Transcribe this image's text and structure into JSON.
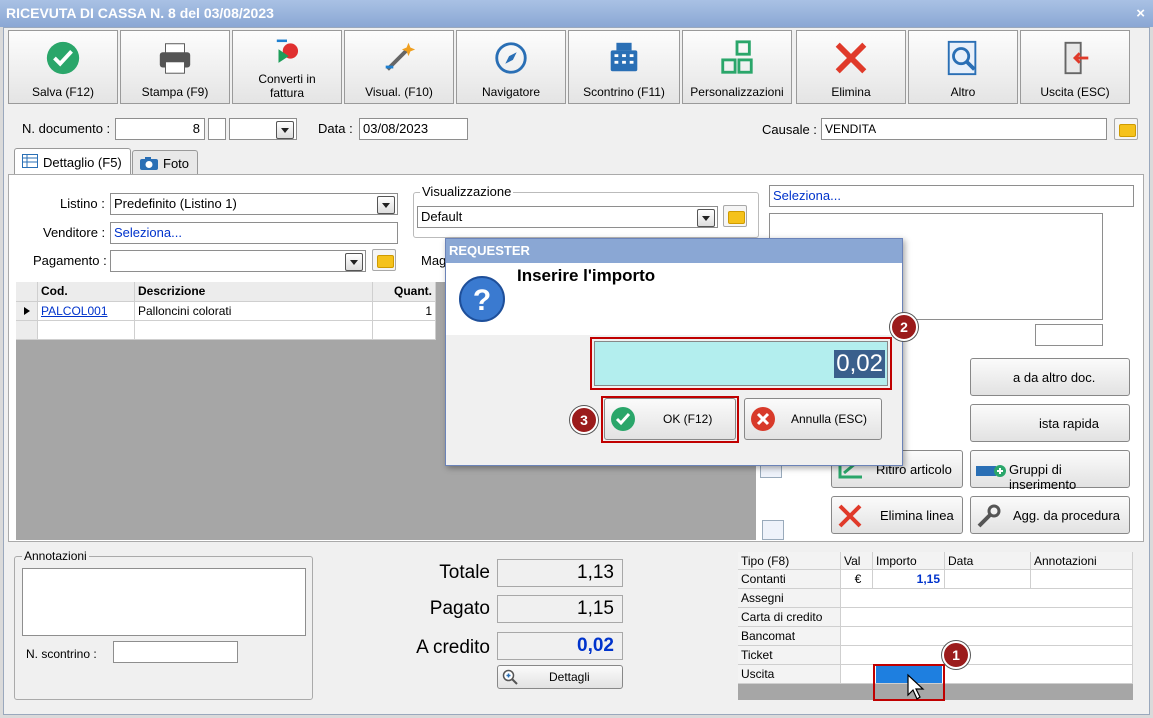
{
  "window": {
    "title": "RICEVUTA DI CASSA N. 8 del 03/08/2023",
    "close": "×"
  },
  "toolbar": {
    "salva": "Salva (F12)",
    "stampa": "Stampa (F9)",
    "converti_1": "Converti in",
    "converti_2": "fattura",
    "visual": "Visual. (F10)",
    "navigatore": "Navigatore",
    "scontrino": "Scontrino (F11)",
    "personalizzazioni": "Personalizzazioni",
    "elimina": "Elimina",
    "altro": "Altro",
    "uscita": "Uscita (ESC)"
  },
  "header": {
    "ndoc_label": "N. documento :",
    "ndoc_value": "8",
    "data_label": "Data :",
    "data_value": "03/08/2023",
    "causale_label": "Causale :",
    "causale_value": "VENDITA"
  },
  "tabs": {
    "dettaglio": "Dettaglio (F5)",
    "foto": "Foto"
  },
  "form": {
    "listino_label": "Listino :",
    "listino_value": "Predefinito (Listino 1)",
    "venditore_label": "Venditore :",
    "venditore_value": "Seleziona...",
    "pagamento_label": "Pagamento :",
    "visualizzazione_label": "Visualizzazione",
    "visualizzazione_value": "Default",
    "mag_label": "Mag",
    "right_select": "Seleziona..."
  },
  "grid": {
    "headers": [
      "Cod.",
      "Descrizione",
      "Quant."
    ],
    "rows": [
      {
        "cod": "PALCOL001",
        "desc": "Palloncini colorati",
        "qty": "1"
      }
    ]
  },
  "right_buttons": {
    "da_altro": "a da altro doc.",
    "lista_rapida": "ista rapida",
    "ritiro": "Ritiro articolo",
    "gruppi": "Gruppi di inserimento",
    "elimina_linea": "Elimina linea",
    "agg": "Agg. da procedura"
  },
  "notes": {
    "label": "Annotazioni",
    "scontrino_label": "N. scontrino :"
  },
  "totals": {
    "totale_label": "Totale",
    "totale": "1,13",
    "pagato_label": "Pagato",
    "pagato": "1,15",
    "credito_label": "A credito",
    "credito": "0,02",
    "dettagli": "Dettagli"
  },
  "payments": {
    "headers": [
      "Tipo (F8)",
      "Val",
      "Importo",
      "Data",
      "Annotazioni"
    ],
    "rows": [
      {
        "tipo": "Contanti",
        "val": "€",
        "importo": "1,15"
      },
      {
        "tipo": "Assegni",
        "val": "",
        "importo": ""
      },
      {
        "tipo": "Carta di credito",
        "val": "",
        "importo": ""
      },
      {
        "tipo": "Bancomat",
        "val": "",
        "importo": ""
      },
      {
        "tipo": "Ticket",
        "val": "",
        "importo": ""
      },
      {
        "tipo": "Uscita",
        "val": "",
        "importo": ""
      }
    ]
  },
  "dialog": {
    "title": "REQUESTER",
    "prompt": "Inserire l'importo",
    "value": "0,02",
    "ok": "OK (F12)",
    "cancel": "Annulla (ESC)"
  },
  "callouts": {
    "c1": "1",
    "c2": "2",
    "c3": "3"
  },
  "colors": {
    "title_blue": "#8aa7d4",
    "callout_red": "#9b1b1b",
    "highlight_red": "#c00000",
    "input_cyan": "#b3eeee",
    "selected_blue": "#1e7fe0"
  }
}
